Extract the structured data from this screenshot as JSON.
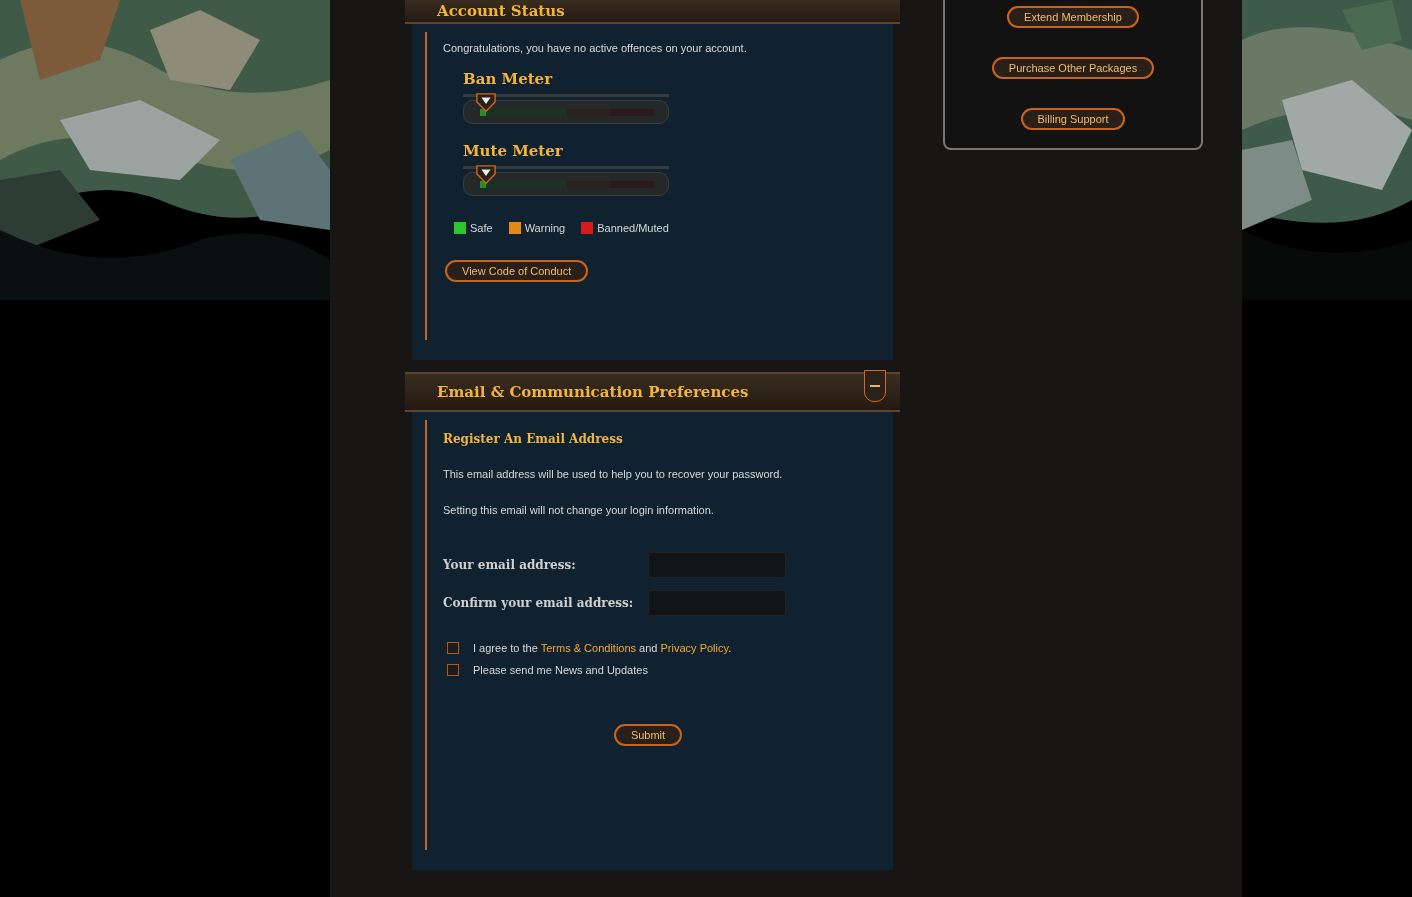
{
  "account_status": {
    "title": "Account Status",
    "message": "Congratulations, you have no active offences on your account.",
    "meters": [
      {
        "label": "Ban Meter",
        "level": 0.03
      },
      {
        "label": "Mute Meter",
        "level": 0.03
      }
    ],
    "legend": [
      {
        "label": "Safe",
        "color": "#2fc42f"
      },
      {
        "label": "Warning",
        "color": "#e08a18"
      },
      {
        "label": "Banned/Muted",
        "color": "#d41c1c"
      }
    ],
    "button": "View Code of Conduct"
  },
  "email_preferences": {
    "title": "Email & Communication Preferences",
    "expanded": true,
    "subtitle": "Register An Email Address",
    "paragraphs": [
      "This email address will be used to help you to recover your password.",
      "Setting this email will not change your login information."
    ],
    "fields": [
      {
        "label": "Your email address:"
      },
      {
        "label": "Confirm your email address:"
      }
    ],
    "checkboxes": [
      {
        "parts": [
          {
            "text": "I agree to the ",
            "link": false
          },
          {
            "text": "Terms & Conditions",
            "link": true
          },
          {
            "text": " and ",
            "link": false
          },
          {
            "text": "Privacy Policy",
            "link": true
          },
          {
            "text": ".",
            "link": false
          }
        ],
        "checked": false
      },
      {
        "parts": [
          {
            "text": "Please send me News and Updates",
            "link": false
          }
        ],
        "checked": false
      }
    ],
    "submit": "Submit"
  },
  "sidebar": {
    "buttons": [
      "Extend Membership",
      "Purchase Other Packages",
      "Billing Support"
    ]
  }
}
